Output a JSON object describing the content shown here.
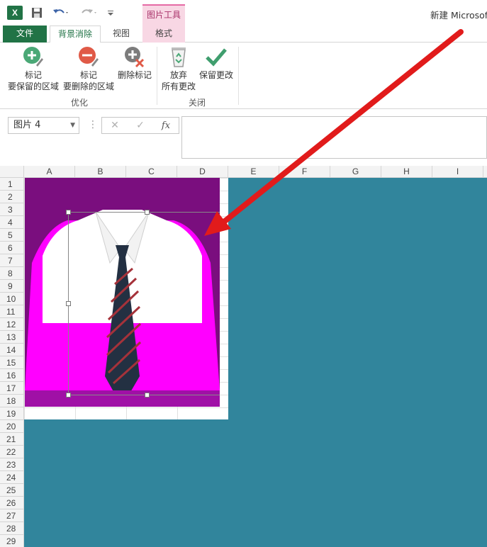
{
  "window": {
    "title": "新建 Microsoft"
  },
  "quick_access": {
    "app_icon": "excel-logo-icon",
    "app_letter": "X"
  },
  "context_tab": {
    "label": "图片工具"
  },
  "tabs": [
    {
      "label": "文件"
    },
    {
      "label": "背景消除"
    },
    {
      "label": "视图"
    },
    {
      "label": "格式"
    }
  ],
  "ribbon": {
    "mark_keep": {
      "line1": "标记",
      "line2": "要保留的区域"
    },
    "mark_remove": {
      "line1": "标记",
      "line2": "要删除的区域"
    },
    "delete_mark": {
      "line1": "删除标记"
    },
    "discard": {
      "line1": "放弃",
      "line2": "所有更改"
    },
    "keep": {
      "line1": "保留更改"
    },
    "groups": {
      "optimize": "优化",
      "close": "关闭"
    }
  },
  "formula_bar": {
    "name_box": "图片 4",
    "cancel": "✕",
    "confirm": "✓",
    "fx": "fx",
    "value": ""
  },
  "columns": [
    "A",
    "B",
    "C",
    "D",
    "E",
    "F",
    "G",
    "H",
    "I"
  ],
  "rows": [
    "1",
    "2",
    "3",
    "4",
    "5",
    "6",
    "7",
    "8",
    "9",
    "10",
    "11",
    "12",
    "13",
    "14",
    "15",
    "16",
    "17",
    "18",
    "19",
    "20",
    "21",
    "22",
    "23",
    "24",
    "25",
    "26",
    "27",
    "28",
    "29"
  ],
  "colors": {
    "excel_green": "#217346",
    "context_pink": "#f8d7e4",
    "removal_magenta": "#ff00ff",
    "removal_dark": "#7a0e7e",
    "overlay_teal": "#31859c",
    "arrow_red": "#e11b1b"
  }
}
